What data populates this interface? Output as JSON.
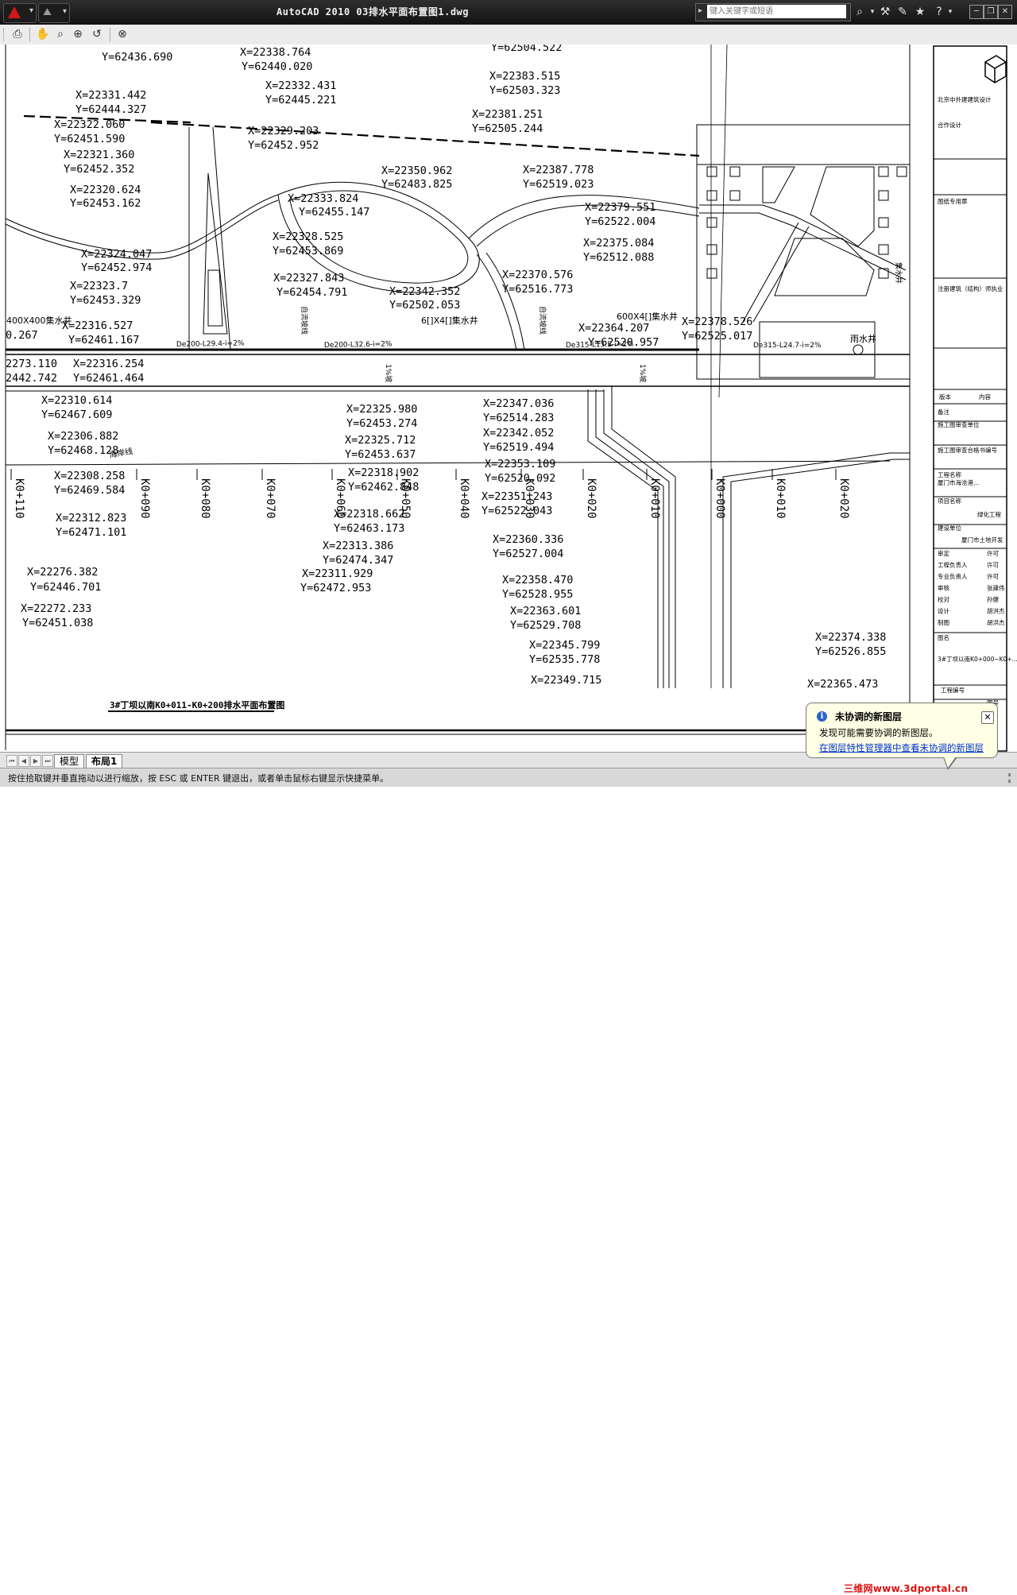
{
  "window": {
    "title": "AutoCAD 2010   03排水平面布置图1.dwg",
    "search_placeholder": "键入关键字或短语"
  },
  "toolbar": {
    "buttons": [
      "plot-icon",
      "pan-icon",
      "zoom-realtime-icon",
      "zoom-window-icon",
      "zoom-previous-icon",
      "close-view-icon"
    ]
  },
  "drawing": {
    "coordinate_labels": [
      "Y=62436.690",
      "X=22338.764",
      "Y=62440.020",
      "Y=62504.522",
      "X=22383.515",
      "Y=62503.323",
      "X=22331.442",
      "Y=62444.327",
      "X=22332.431",
      "Y=62445.221",
      "X=22381.251",
      "Y=62505.244",
      "X=22322.060",
      "Y=62451.590",
      "X=22329.203",
      "Y=62452.952",
      "X=22321.360",
      "Y=62452.352",
      "X=22350.962",
      "Y=62483.825",
      "X=22387.778",
      "Y=62519.023",
      "X=22320.624",
      "Y=62453.162",
      "X=22333.824",
      "Y=62455.147",
      "X=22379.551",
      "Y=62522.004",
      "X=22328.525",
      "Y=62453.869",
      "X=22375.084",
      "Y=62512.088",
      "X=22324.047",
      "Y=62452.974",
      "X=22327.843",
      "Y=62454.791",
      "X=22370.576",
      "Y=62516.773",
      "X=22323.7",
      "Y=62453.329",
      "X=22342.352",
      "Y=62502.053",
      "X=22316.527",
      "Y=62461.167",
      "X=22364.207",
      "Y=62520.957",
      "X=22378.526",
      "Y=62525.017",
      "0.267",
      "2273.110",
      "X=22316.254",
      "2442.742",
      "Y=62461.464",
      "X=22310.614",
      "Y=62467.609",
      "X=22325.980",
      "Y=62453.274",
      "X=22347.036",
      "Y=62514.283",
      "X=22306.882",
      "Y=62468.128",
      "X=22325.712",
      "Y=62453.637",
      "X=22342.052",
      "Y=62519.494",
      "X=22308.258",
      "Y=62469.584",
      "X=22318.902",
      "Y=62462.848",
      "X=22353.109",
      "Y=62520.092",
      "X=22351.243",
      "Y=62522.043",
      "X=22312.823",
      "Y=62471.101",
      "X=22318.662",
      "Y=62463.173",
      "X=22360.336",
      "Y=62527.004",
      "X=22313.386",
      "Y=62474.347",
      "X=22276.382",
      "Y=62446.701",
      "X=22311.929",
      "Y=62472.953",
      "X=22358.470",
      "Y=62528.955",
      "X=22272.233",
      "Y=62451.038",
      "X=22363.601",
      "Y=62529.708",
      "X=22374.338",
      "Y=62526.855",
      "X=22345.799",
      "Y=62535.778",
      "X=22349.715",
      "X=22365.473"
    ],
    "pipe_labels": [
      "De200-L29.4-i=2%",
      "De200-L32.6-i=2%",
      "De315-L24.7-i=2%",
      "De315-L13.5-i=2%"
    ],
    "well_labels": [
      "400X400集水井",
      "6[]X4[]集水井",
      "600X4[]集水井",
      "雨水井"
    ],
    "chainage_labels": [
      "K0+110",
      "K0+090",
      "K0+080",
      "K0+070",
      "K0+060",
      "K0+050",
      "K0+040",
      "K0+030",
      "K0+020",
      "K0+010",
      "K0+000",
      "K0+010",
      "K0+020"
    ],
    "misc_labels": [
      "海岸线",
      "1%坡",
      "1%坡",
      "自流坡线",
      "自流坡线",
      "集水井"
    ],
    "drawing_title": "3#丁坝以南K0+011-K0+200排水平面布置图"
  },
  "title_block": {
    "company": "北京中外建建筑设计",
    "partner": "合作设计",
    "stamp": "图纸专用章",
    "reg_engineer": "注册建筑（结构）师执业",
    "version_col": "版本",
    "content_col": "内容",
    "note": "备注",
    "check_unit": "施工图审查单位",
    "cert_no": "施工图审查合格书编号",
    "project_name_label": "工程名称",
    "project_name_value": "厦门市海沧港...",
    "item_name_label": "项目名称",
    "item_name_value": "绿化工程",
    "client_label": "建设单位",
    "client_value": "厦门市土地开发",
    "signoff_rows": [
      {
        "role": "审定",
        "name": "许可"
      },
      {
        "role": "工程负责人",
        "name": "许可"
      },
      {
        "role": "专业负责人",
        "name": "许可"
      },
      {
        "role": "审核",
        "name": "张建伟"
      },
      {
        "role": "校对",
        "name": "孙健"
      },
      {
        "role": "设计",
        "name": "胡洪杰"
      },
      {
        "role": "制图",
        "name": "胡洪杰"
      }
    ],
    "drawing_name_label": "图名",
    "drawing_name_value": "3#丁坝以南K0+000~K0+...",
    "project_no_label": "工程编号",
    "drawing_no_label": "图号"
  },
  "layout_tabs": [
    {
      "label": "模型",
      "active": false
    },
    {
      "label": "布局1",
      "active": true
    }
  ],
  "status": {
    "prompt": "按住拾取键并垂直拖动以进行缩放，按 ESC 或 ENTER 键退出，或者单击鼠标右键显示快捷菜单。"
  },
  "notification": {
    "title": "未协调的新图层",
    "message": "发现可能需要协调的新图层。",
    "link": "在图层特性管理器中查看未协调的新图层"
  },
  "watermark": "三维网www.3dportal.cn",
  "colors": {
    "titlebar": "#1a1a1a",
    "drawing_bg": "#ffffff",
    "line": "#000000",
    "balloon_bg": "#ffffe6",
    "link": "#0033cc",
    "watermark": "#dd1111"
  }
}
